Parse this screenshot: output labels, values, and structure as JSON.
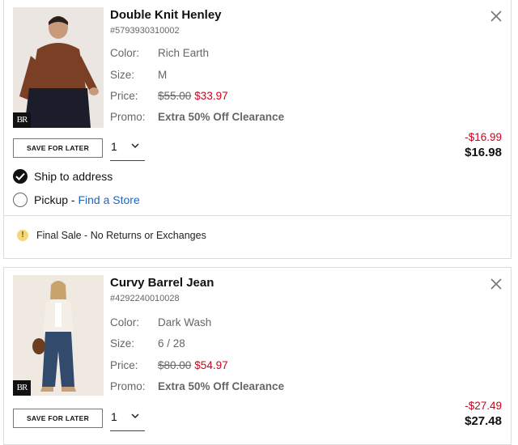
{
  "items": [
    {
      "title": "Double Knit Henley",
      "sku": "#5793930310002",
      "color_label": "Color:",
      "color_value": "Rich Earth",
      "size_label": "Size:",
      "size_value": "M",
      "price_label": "Price:",
      "original_price": "$55.00",
      "sale_price": "$33.97",
      "promo_label": "Promo:",
      "promo_value": "Extra 50% Off Clearance",
      "save_label": "SAVE FOR LATER",
      "quantity": "1",
      "discount": "-$16.99",
      "total": "$16.98",
      "brand_logo": "BR"
    },
    {
      "title": "Curvy Barrel Jean",
      "sku": "#4292240010028",
      "color_label": "Color:",
      "color_value": "Dark Wash",
      "size_label": "Size:",
      "size_value": "6 / 28",
      "price_label": "Price:",
      "original_price": "$80.00",
      "sale_price": "$54.97",
      "promo_label": "Promo:",
      "promo_value": "Extra 50% Off Clearance",
      "save_label": "SAVE FOR LATER",
      "quantity": "1",
      "discount": "-$27.49",
      "total": "$27.48",
      "brand_logo": "BR"
    }
  ],
  "shipping": {
    "ship_label": "Ship to address",
    "pickup_label": "Pickup - ",
    "find_store": "Find a Store",
    "selected": "ship"
  },
  "notice": {
    "icon": "!",
    "text": "Final Sale - No Returns or Exchanges"
  },
  "colors": {
    "sale_red": "#d0021b",
    "link_blue": "#1a64c8",
    "warning_yellow": "#f5d77a"
  }
}
